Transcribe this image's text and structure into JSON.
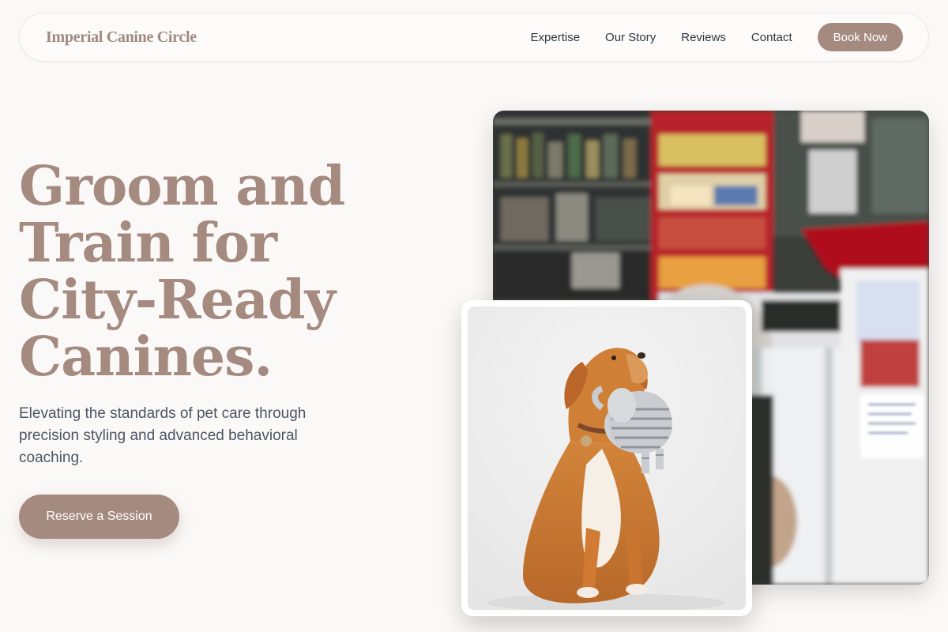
{
  "brand": {
    "name": "Imperial Canine Circle"
  },
  "nav": {
    "links": [
      "Expertise",
      "Our Story",
      "Reviews",
      "Contact"
    ],
    "cta": "Book Now"
  },
  "hero": {
    "title_lines": [
      "Groom and",
      "Train for",
      "City-Ready",
      "Canines."
    ],
    "subtitle": "Elevating the standards of pet care through precision styling and advanced behavioral coaching.",
    "cta": "Reserve a Session"
  },
  "images": {
    "back": "pet-shop-store-photo",
    "front": "dog-with-toy-photo"
  },
  "colors": {
    "accent": "#a58a80",
    "background": "#fbf9f7",
    "text": "#2f3640"
  }
}
